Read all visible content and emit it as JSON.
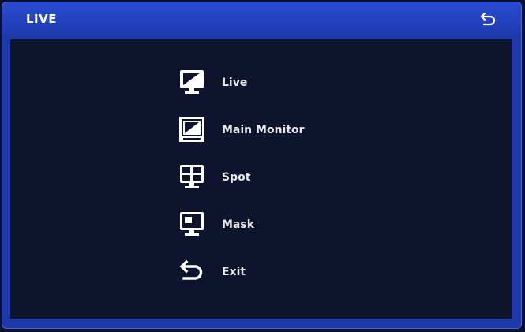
{
  "window": {
    "title": "LIVE",
    "back_icon": "return-arrow-icon"
  },
  "menu": {
    "items": [
      {
        "label": "Live",
        "icon": "monitor-live-icon"
      },
      {
        "label": "Main Monitor",
        "icon": "main-monitor-icon"
      },
      {
        "label": "Spot",
        "icon": "spot-grid-monitor-icon"
      },
      {
        "label": "Mask",
        "icon": "mask-monitor-icon"
      },
      {
        "label": "Exit",
        "icon": "exit-return-icon"
      }
    ]
  },
  "colors": {
    "titlebar": "#1e3bb0",
    "content_bg": "#0e142e",
    "text": "#ffffff"
  }
}
